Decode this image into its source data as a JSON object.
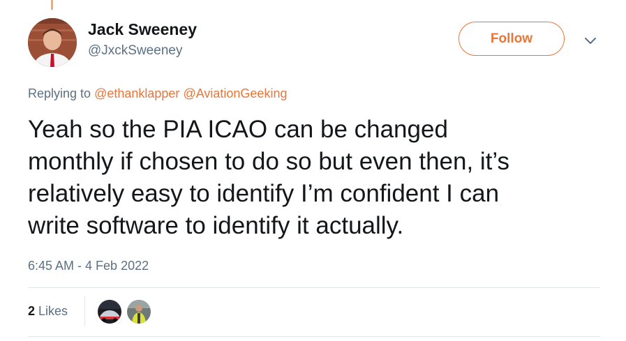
{
  "author": {
    "name": "Jack Sweeney",
    "handle": "@JxckSweeney"
  },
  "follow_button": {
    "label": "Follow"
  },
  "reply": {
    "prefix": "Replying to ",
    "mentions": [
      "@ethanklapper",
      "@AviationGeeking"
    ]
  },
  "tweet": {
    "lines": [
      "Yeah so the PIA ICAO can be changed",
      "monthly if chosen to do so but even then, it’s",
      "relatively easy to identify I’m confident I can",
      "write software to identify it actually."
    ],
    "timestamp": "6:45 AM - 4 Feb 2022"
  },
  "stats": {
    "likes_count": "2",
    "likes_label": "Likes"
  },
  "colors": {
    "accent": "#e8753a",
    "secondary_text": "#5b7083",
    "primary_text": "#14171a",
    "divider": "#e1e8ed"
  },
  "icons": {
    "more": "chevron-down-icon"
  }
}
